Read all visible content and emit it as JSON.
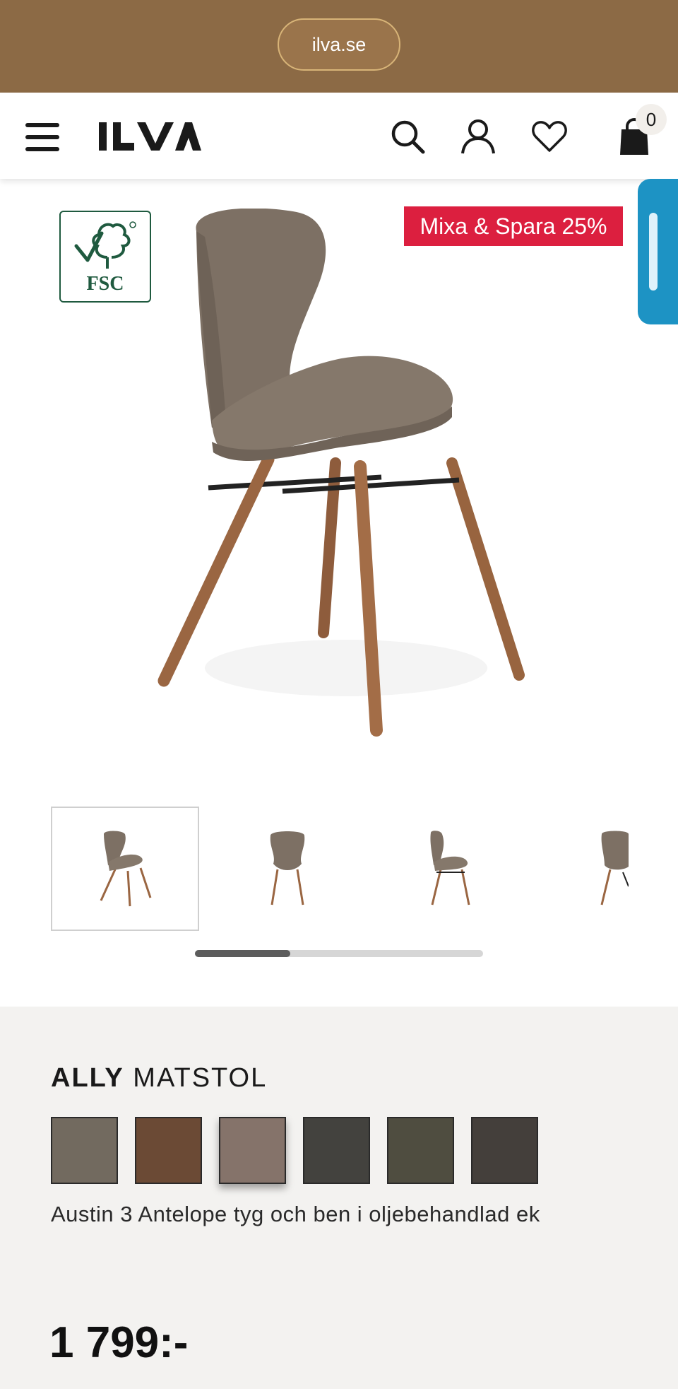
{
  "browser": {
    "url": "ilva.se"
  },
  "header": {
    "logo_text": "ILVA",
    "cart_count": "0",
    "icons": [
      "menu-icon",
      "search-icon",
      "account-icon",
      "heart-icon",
      "cart-icon"
    ]
  },
  "hero": {
    "certification": "FSC",
    "promo_label": "Mixa & Spara 25%"
  },
  "gallery": {
    "thumbnails": [
      "chair-angle-front",
      "chair-front",
      "chair-side",
      "chair-back"
    ],
    "active_index": 0,
    "scroll_progress": 0.33
  },
  "product": {
    "brand": "ALLY",
    "type": "MATSTOL",
    "variant_description": "Austin 3 Antelope tyg och ben i oljebehandlad ek",
    "price": "1 799:-",
    "swatches": [
      {
        "color": "#726a5f"
      },
      {
        "color": "#6b4a35"
      },
      {
        "color": "#85736a",
        "selected": true
      },
      {
        "color": "#43423e"
      },
      {
        "color": "#4f4d40"
      },
      {
        "color": "#443f3b"
      }
    ]
  },
  "colors": {
    "browser_bar": "#8c6a45",
    "promo": "#dc1f3f",
    "side_tab": "#1d93c4",
    "fsc_green": "#1f5a3f"
  }
}
